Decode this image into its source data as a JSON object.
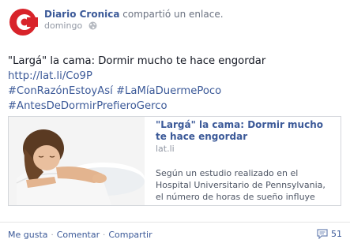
{
  "post": {
    "page_name": "Diario Cronica",
    "action_text": "compartió un enlace.",
    "timestamp": "domingo",
    "privacy_icon": "globe-icon",
    "text": "\"Largá\" la cama: Dormir mucho te hace engordar",
    "link": "http://lat.li/Co9P",
    "hashtags": [
      "#ConRazónEstoyAsí",
      "#LaMíaDuermePoco",
      "#AntesDeDormirPrefieroGerco"
    ]
  },
  "link_card": {
    "title": "\"Largá\" la cama: Dormir mucho te hace engordar",
    "domain": "lat.li",
    "description": "Según un estudio realizado en el Hospital Universitario de Pennsylvania, el número de horas de sueño influye"
  },
  "footer": {
    "like_label": "Me gusta",
    "comment_label": "Comentar",
    "share_label": "Compartir",
    "separator": "·",
    "comment_count": "51",
    "comment_icon": "comment-icon"
  },
  "colors": {
    "link": "#3b5998",
    "brand_red": "#d8232a",
    "muted": "#9197a3"
  }
}
